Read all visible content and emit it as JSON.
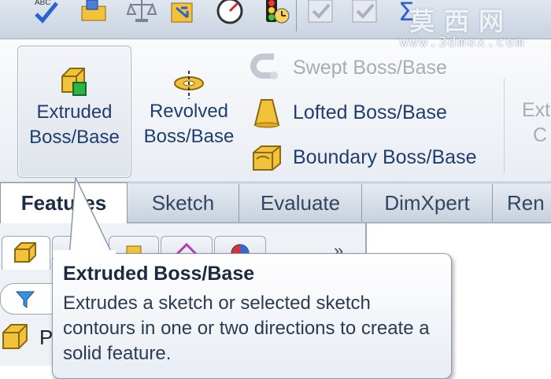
{
  "watermark": {
    "title": "莫西网",
    "url": "www.3dmox.com"
  },
  "toolbar": {
    "icons": [
      "spell-check-icon",
      "measure-icon",
      "mass-properties-icon",
      "section-icon",
      "performance-icon",
      "timer-icon",
      "check-icon",
      "check-icon",
      "sum-icon"
    ]
  },
  "ribbon": {
    "extruded": {
      "line1": "Extruded",
      "line2": "Boss/Base"
    },
    "revolved": {
      "line1": "Revolved",
      "line2": "Boss/Base"
    },
    "swept": "Swept Boss/Base",
    "lofted": "Lofted Boss/Base",
    "boundary": "Boundary Boss/Base",
    "extruded_cut_partial": {
      "line1": "Ext",
      "line2": "C"
    }
  },
  "tabs": [
    "Features",
    "Sketch",
    "Evaluate",
    "DimXpert",
    "Ren"
  ],
  "panel": {
    "chevron": "»",
    "tree_partial_label": "P"
  },
  "tooltip": {
    "title": "Extruded Boss/Base",
    "body": "Extrudes a sketch or selected sketch contours in one or two directions to create a solid feature."
  },
  "colors": {
    "accent": "#1f3e6d",
    "disabled": "#a7adb5",
    "icon_gold": "#f2c23a",
    "icon_green": "#2db34a"
  }
}
